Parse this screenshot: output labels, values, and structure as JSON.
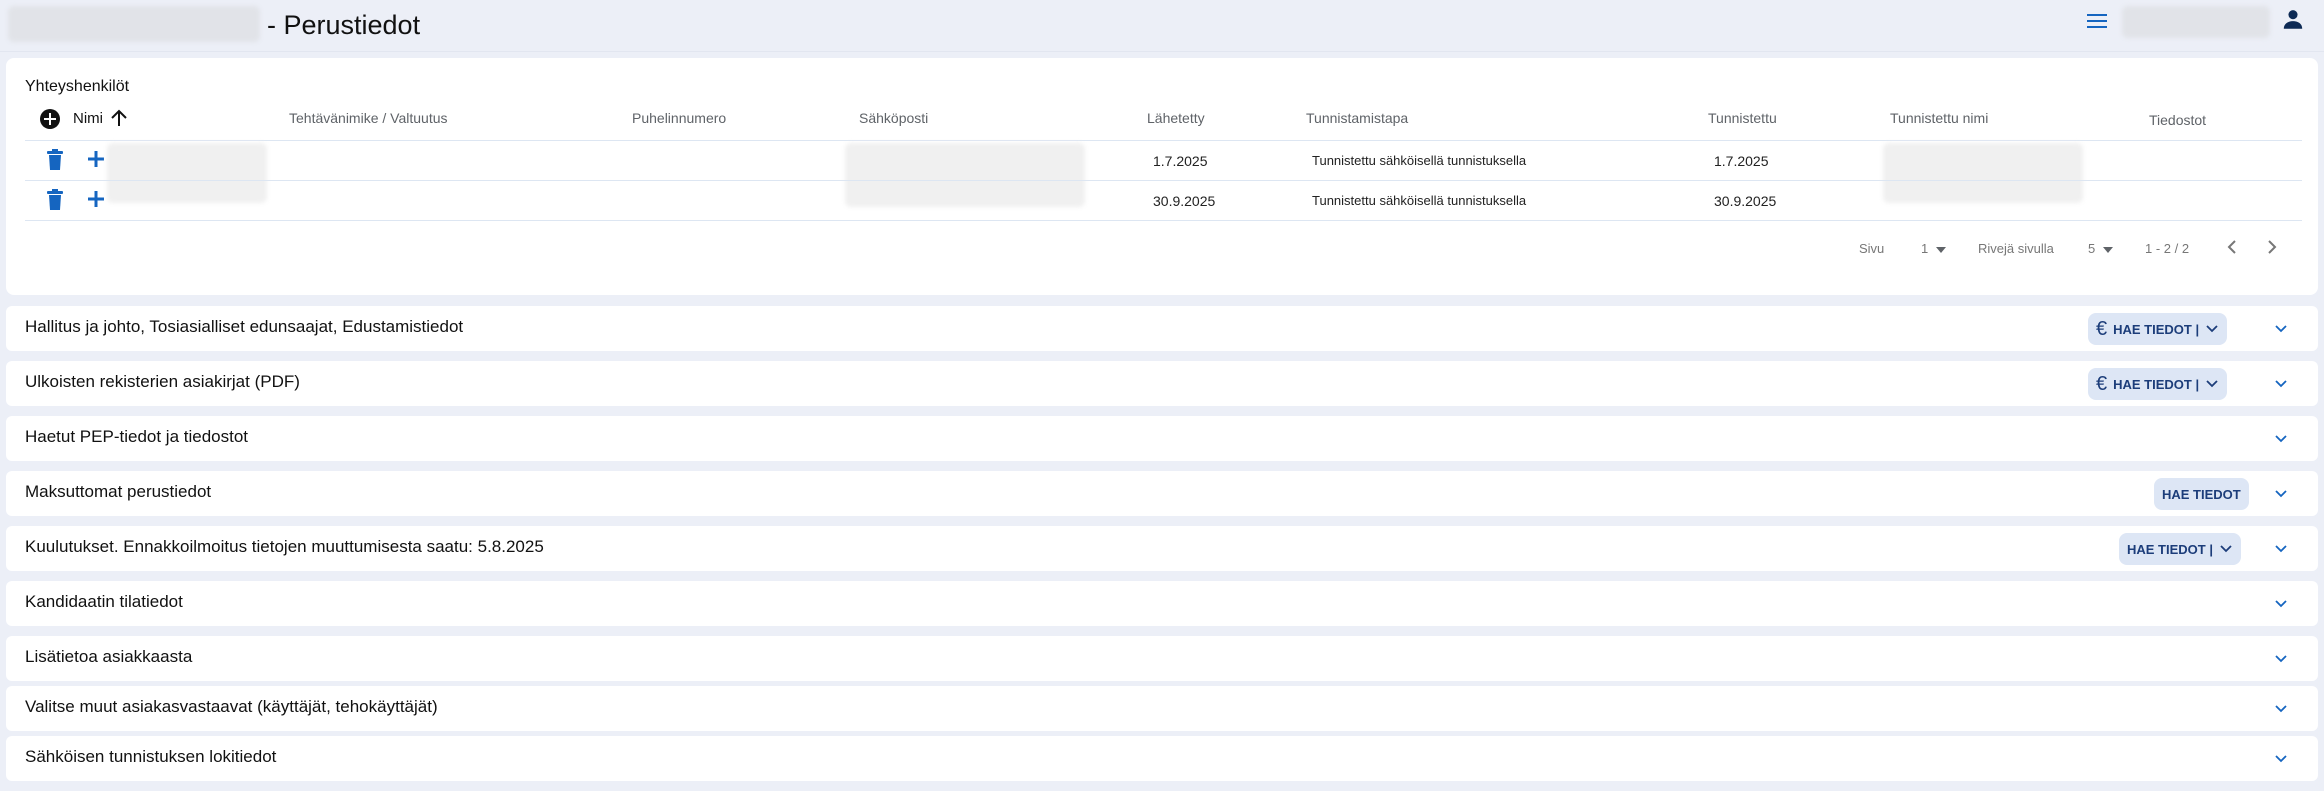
{
  "header": {
    "title": "- Perustiedot"
  },
  "contacts": {
    "title": "Yhteyshenkilöt",
    "columns": {
      "name": "Nimi",
      "role": "Tehtävänimike / Valtuutus",
      "phone": "Puhelinnumero",
      "email": "Sähköposti",
      "sent": "Lähetetty",
      "auth_method": "Tunnistamistapa",
      "authenticated": "Tunnistettu",
      "auth_name": "Tunnistettu nimi",
      "files": "Tiedostot"
    },
    "rows": [
      {
        "sent": "1.7.2025",
        "auth_method": "Tunnistettu sähköisellä tunnistuksella",
        "authenticated": "1.7.2025"
      },
      {
        "sent": "30.9.2025",
        "auth_method": "Tunnistettu sähköisellä tunnistuksella",
        "authenticated": "30.9.2025"
      }
    ],
    "pager": {
      "page_label": "Sivu",
      "page_value": "1",
      "rows_label": "Rivejä sivulla",
      "rows_value": "5",
      "range": "1 - 2 / 2"
    }
  },
  "sections": [
    {
      "title": "Hallitus ja johto, Tosiasialliset edunsaajat, Edustamistiedot",
      "button": "HAE TIEDOT |"
    },
    {
      "title": "Ulkoisten rekisterien asiakirjat (PDF)",
      "button": "HAE TIEDOT |"
    },
    {
      "title": "Haetut PEP-tiedot ja tiedostot"
    },
    {
      "title": "Maksuttomat perustiedot",
      "button": "HAE TIEDOT"
    },
    {
      "title": "Kuulutukset. Ennakkoilmoitus tietojen muuttumisesta saatu: 5.8.2025",
      "button": "HAE TIEDOT |"
    },
    {
      "title": "Kandidaatin tilatiedot"
    },
    {
      "title": "Lisätietoa asiakkaasta"
    },
    {
      "title": "Valitse muut asiakasvastaavat (käyttäjät, tehokäyttäjät)"
    },
    {
      "title": "Sähköisen tunnistuksen lokitiedot"
    }
  ],
  "colors": {
    "accent": "#1565c0",
    "background": "#eceff7",
    "button_bg": "#dde6f5"
  },
  "icons": {
    "menu": "hamburger-menu-icon",
    "user": "account-icon",
    "add": "add-circle-icon",
    "sort": "arrow-up-icon",
    "delete": "trash-icon",
    "expand": "chevron-down-icon",
    "euro": "euro-icon"
  }
}
